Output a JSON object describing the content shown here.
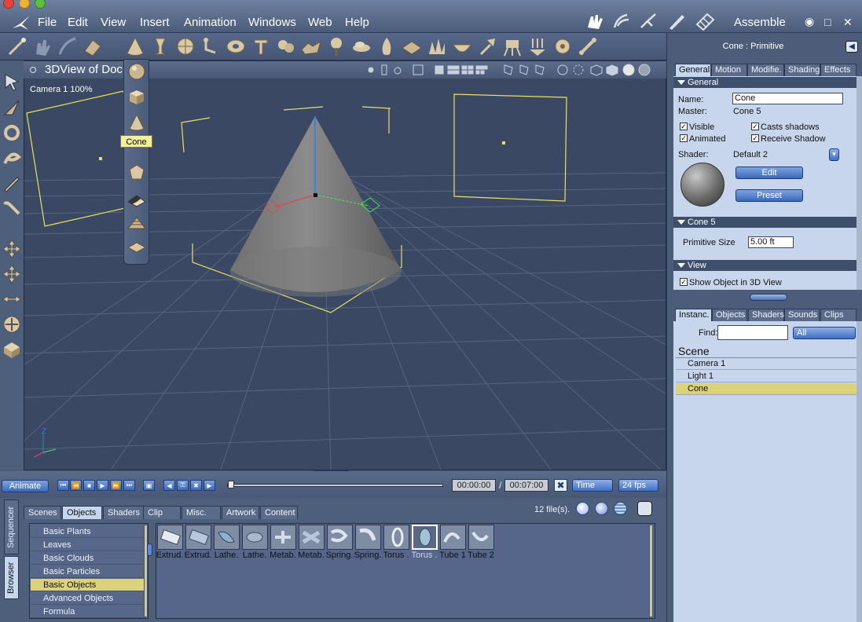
{
  "menubar": {
    "items": [
      "File",
      "Edit",
      "View",
      "Insert",
      "Animation",
      "Windows",
      "Web",
      "Help"
    ],
    "mode_label": "Assemble"
  },
  "viewport": {
    "title": "3DView of Doc",
    "camera_label": "Camera 1 100%",
    "axis_label": "Z"
  },
  "primitive_menu": {
    "tooltip": "Cone"
  },
  "timeline": {
    "animate_label": "Animate",
    "current_time": "00:00:00",
    "separator": "/",
    "end_time": "00:07:00",
    "time_mode": "Time",
    "fps": "24 fps"
  },
  "browser": {
    "side_tabs": [
      "Sequencer",
      "Browser"
    ],
    "tabs": [
      "Scenes",
      "Objects",
      "Shaders",
      "Clip",
      "Misc.",
      "Artwork",
      "Content"
    ],
    "active_tab": "Objects",
    "file_count": "12 file(s).",
    "categories": [
      "Basic Plants",
      "Leaves",
      "Basic Clouds",
      "Basic Particles",
      "Basic Objects",
      "Advanced Objects",
      "Formula"
    ],
    "selected_category": "Basic Objects",
    "files": [
      "Extrud.",
      "Extrud.",
      "Lathe.",
      "Lathe.",
      "Metab.",
      "Metab.",
      "Spring.",
      "Spring.",
      "Torus .",
      "Torus .",
      "Tube 1",
      "Tube 2"
    ],
    "selected_file_index": 9
  },
  "right_panel": {
    "title": "Cone : Primitive",
    "tabs": [
      "General",
      "Motion",
      "Modifie.",
      "Shading",
      "Effects"
    ],
    "active_tab": "General",
    "general_section": "General",
    "name_label": "Name:",
    "name_value": "Cone",
    "master_label": "Master:",
    "master_value": "Cone 5",
    "visible_label": "Visible",
    "casts_shadows_label": "Casts shadows",
    "animated_label": "Animated",
    "receive_shadow_label": "Receive Shadow",
    "shader_label": "Shader:",
    "shader_value": "Default 2",
    "edit_label": "Edit",
    "preset_label": "Preset",
    "cone_section": "Cone 5",
    "primitive_size_label": "Primitive Size",
    "primitive_size_value": "5.00 ft",
    "view_section": "View",
    "show_in_3d_label": "Show Object in 3D View"
  },
  "instances_panel": {
    "tabs": [
      "Instanc.",
      "Objects",
      "Shaders",
      "Sounds",
      "Clips"
    ],
    "active_tab": "Instanc.",
    "find_label": "Find:",
    "find_value": "",
    "filter_value": "All",
    "scene_label": "Scene",
    "items": [
      "Camera 1",
      "Light 1",
      "Cone"
    ],
    "selected_item": "Cone"
  },
  "colors": {
    "panel_bg": "#4d5d79",
    "viewport_bg": "#3a4863",
    "property_bg": "#c7d6ec",
    "selection": "#dcd27a",
    "accent_button": "#3a69bd"
  }
}
